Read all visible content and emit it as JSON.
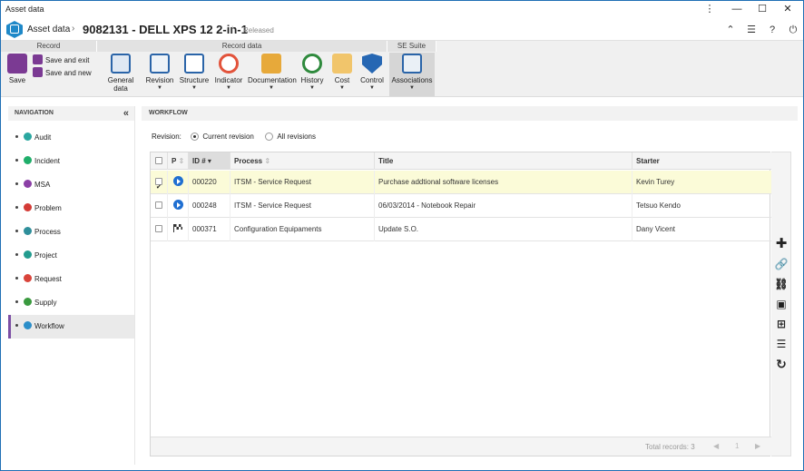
{
  "window": {
    "title": "Asset data"
  },
  "header": {
    "breadcrumb": "Asset data",
    "title": "9082131 - DELL XPS 12 2-in-1",
    "status": "Released"
  },
  "ribbon": {
    "groups": {
      "record": "Record",
      "record_data": "Record data",
      "se_suite": "SE Suite"
    },
    "save": "Save",
    "save_and_exit": "Save and exit",
    "save_and_new": "Save and new",
    "general_data": "General data",
    "revision": "Revision",
    "structure": "Structure",
    "indicator": "Indicator",
    "documentation": "Documentation",
    "history": "History",
    "cost": "Cost",
    "control": "Control",
    "associations": "Associations"
  },
  "navigation": {
    "title": "NAVIGATION",
    "items": [
      {
        "label": "Audit",
        "color": "#2aa7a0"
      },
      {
        "label": "Incident",
        "color": "#1fae6a"
      },
      {
        "label": "MSA",
        "color": "#8b3fa6"
      },
      {
        "label": "Problem",
        "color": "#d43b36"
      },
      {
        "label": "Process",
        "color": "#2f8f9b"
      },
      {
        "label": "Project",
        "color": "#239c8f"
      },
      {
        "label": "Request",
        "color": "#d9443a"
      },
      {
        "label": "Supply",
        "color": "#3a9a3f"
      },
      {
        "label": "Workflow",
        "color": "#2b8ec9"
      }
    ]
  },
  "workflow": {
    "title": "WORKFLOW",
    "revision_label": "Revision:",
    "current_revision": "Current revision",
    "all_revisions": "All revisions",
    "columns": {
      "p": "P",
      "id": "ID #",
      "process": "Process",
      "title": "Title",
      "starter": "Starter"
    },
    "rows": [
      {
        "id": "000220",
        "process": "ITSM - Service Request",
        "title": "Purchase addtional software licenses",
        "starter": "Kevin Turey",
        "selected": true,
        "icon": "play-icon"
      },
      {
        "id": "000248",
        "process": "ITSM - Service Request",
        "title": "06/03/2014 - Notebook Repair",
        "starter": "Tetsuo Kendo",
        "selected": false,
        "icon": "play-icon"
      },
      {
        "id": "000371",
        "process": "Configuration Equipaments",
        "title": "Update S.O.",
        "starter": "Dany Vicent",
        "selected": false,
        "icon": "finish-flag-icon"
      }
    ],
    "total_records": "Total records: 3",
    "page": "1"
  },
  "colors": {
    "accent": "#1f6fb5",
    "selected_row": "#fbfbd8",
    "active_nav": "#7c4ea4"
  }
}
